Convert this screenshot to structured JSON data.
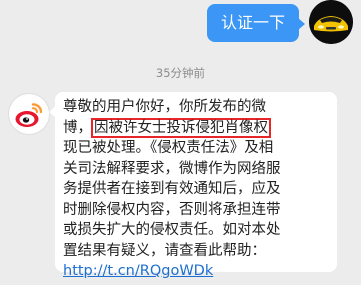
{
  "conversation": {
    "outgoing_message": "认证一下",
    "timestamp": "35分钟前",
    "incoming_message": {
      "lines": [
        "尊敬的用户你好，你所发布的微",
        "博，",
        "现已被处理。《侵权责任法》及相",
        "关司法解释要求，微博作为网络服",
        "务提供者在接到有效通知后，应及",
        "时删除侵权内容，否则将承担连带",
        "或损失扩大的侵权责任。如对本处",
        "置结果有疑义，请查看此帮助："
      ],
      "highlighted_text": "因被许女士投诉侵犯肖像权",
      "help_link": "http://t.cn/RQgoWDk"
    }
  },
  "colors": {
    "outgoing_bubble": "#3b96f5",
    "highlight_border": "#e8262a",
    "link": "#1d6fd1",
    "weibo_red": "#e6162d",
    "weibo_orange": "#ff9933"
  },
  "icons": {
    "user_avatar": "car-avatar-icon",
    "sender_avatar": "weibo-logo-icon"
  }
}
